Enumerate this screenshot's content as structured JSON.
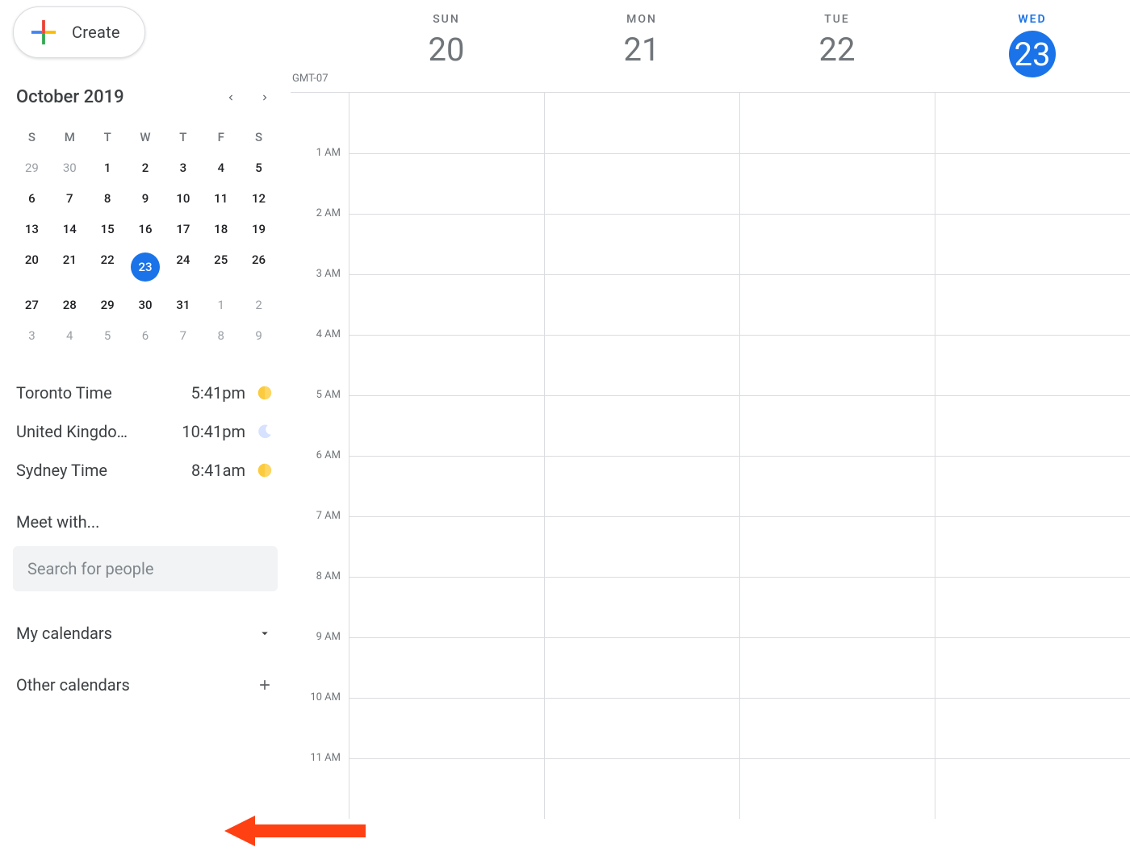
{
  "create_label": "Create",
  "month_title": "October 2019",
  "dow_short": [
    "S",
    "M",
    "T",
    "W",
    "T",
    "F",
    "S"
  ],
  "mini_weeks": [
    [
      {
        "n": "29",
        "out": true
      },
      {
        "n": "30",
        "out": true
      },
      {
        "n": "1"
      },
      {
        "n": "2"
      },
      {
        "n": "3"
      },
      {
        "n": "4"
      },
      {
        "n": "5"
      }
    ],
    [
      {
        "n": "6"
      },
      {
        "n": "7"
      },
      {
        "n": "8"
      },
      {
        "n": "9"
      },
      {
        "n": "10"
      },
      {
        "n": "11"
      },
      {
        "n": "12"
      }
    ],
    [
      {
        "n": "13"
      },
      {
        "n": "14"
      },
      {
        "n": "15"
      },
      {
        "n": "16"
      },
      {
        "n": "17"
      },
      {
        "n": "18"
      },
      {
        "n": "19"
      }
    ],
    [
      {
        "n": "20"
      },
      {
        "n": "21"
      },
      {
        "n": "22"
      },
      {
        "n": "23",
        "today": true
      },
      {
        "n": "24"
      },
      {
        "n": "25"
      },
      {
        "n": "26"
      }
    ],
    [
      {
        "n": "27"
      },
      {
        "n": "28"
      },
      {
        "n": "29"
      },
      {
        "n": "30"
      },
      {
        "n": "31"
      },
      {
        "n": "1",
        "out": true
      },
      {
        "n": "2",
        "out": true
      }
    ],
    [
      {
        "n": "3",
        "out": true
      },
      {
        "n": "4",
        "out": true
      },
      {
        "n": "5",
        "out": true
      },
      {
        "n": "6",
        "out": true
      },
      {
        "n": "7",
        "out": true
      },
      {
        "n": "8",
        "out": true
      },
      {
        "n": "9",
        "out": true
      }
    ]
  ],
  "clocks": [
    {
      "name": "Toronto Time",
      "time": "5:41pm",
      "icon": "sun"
    },
    {
      "name": "United Kingdo…",
      "time": "10:41pm",
      "icon": "moon"
    },
    {
      "name": "Sydney Time",
      "time": "8:41am",
      "icon": "sun"
    }
  ],
  "meet_label": "Meet with...",
  "search_placeholder": "Search for people",
  "my_calendars_label": "My calendars",
  "other_calendars_label": "Other calendars",
  "tz_label": "GMT-07",
  "days": [
    {
      "dow": "SUN",
      "num": "20"
    },
    {
      "dow": "MON",
      "num": "21"
    },
    {
      "dow": "TUE",
      "num": "22"
    },
    {
      "dow": "WED",
      "num": "23",
      "today": true
    }
  ],
  "hours": [
    "1 AM",
    "2 AM",
    "3 AM",
    "4 AM",
    "5 AM",
    "6 AM",
    "7 AM",
    "8 AM",
    "9 AM",
    "10 AM",
    "11 AM"
  ],
  "colors": {
    "accent": "#1a73e8",
    "arrow": "#ff4013"
  }
}
